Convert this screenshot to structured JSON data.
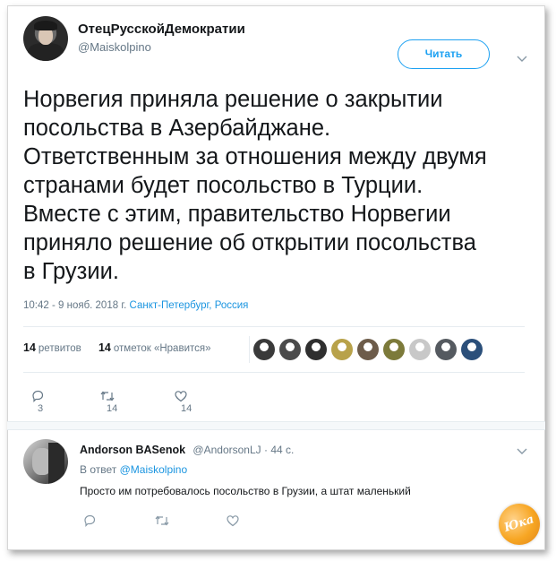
{
  "tweet": {
    "author_name": "ОтецРусскойДемократии",
    "author_handle": "@Maiskolpino",
    "follow_label": "Читать",
    "text": "Норвегия приняла решение о закрытии\nпосольства в Азербайджане.\nОтветственным за отношения между двумя\nстранами будет посольство в Турции.\nВместе с этим, правительство Норвегии\nприняло решение об открытии посольства\nв Грузии.",
    "time": "10:42 - 9 нояб. 2018 г.",
    "location": "Санкт-Петербург, Россия",
    "retweets_count": "14",
    "retweets_label": "ретвитов",
    "likes_count": "14",
    "likes_label": "отметок «Нравится»",
    "replies": "3",
    "retweets_action": "14",
    "likes_action": "14"
  },
  "liker_avatars": [
    "#3a3a3a",
    "#4b4b4b",
    "#2f2f2f",
    "#b8a24a",
    "#6d5c4a",
    "#7c7a3a",
    "#c8c8c8",
    "#555a60",
    "#2b4f7a"
  ],
  "reply": {
    "author_name": "Andorson BASenok",
    "author_handle": "@AndorsonLJ",
    "time": "· 44 с.",
    "in_reply_label": "В ответ",
    "in_reply_handle": "@Maiskolpino",
    "text": "Просто им потребовалось посольство в Грузии, а штат маленький"
  },
  "icons": {
    "reply": "reply-icon",
    "retweet": "retweet-icon",
    "like": "heart-icon",
    "more": "chevron-down-icon"
  },
  "colors": {
    "accent": "#1da1f2",
    "link": "#1b95e0",
    "muted": "#657786"
  },
  "watermark": "Юка"
}
